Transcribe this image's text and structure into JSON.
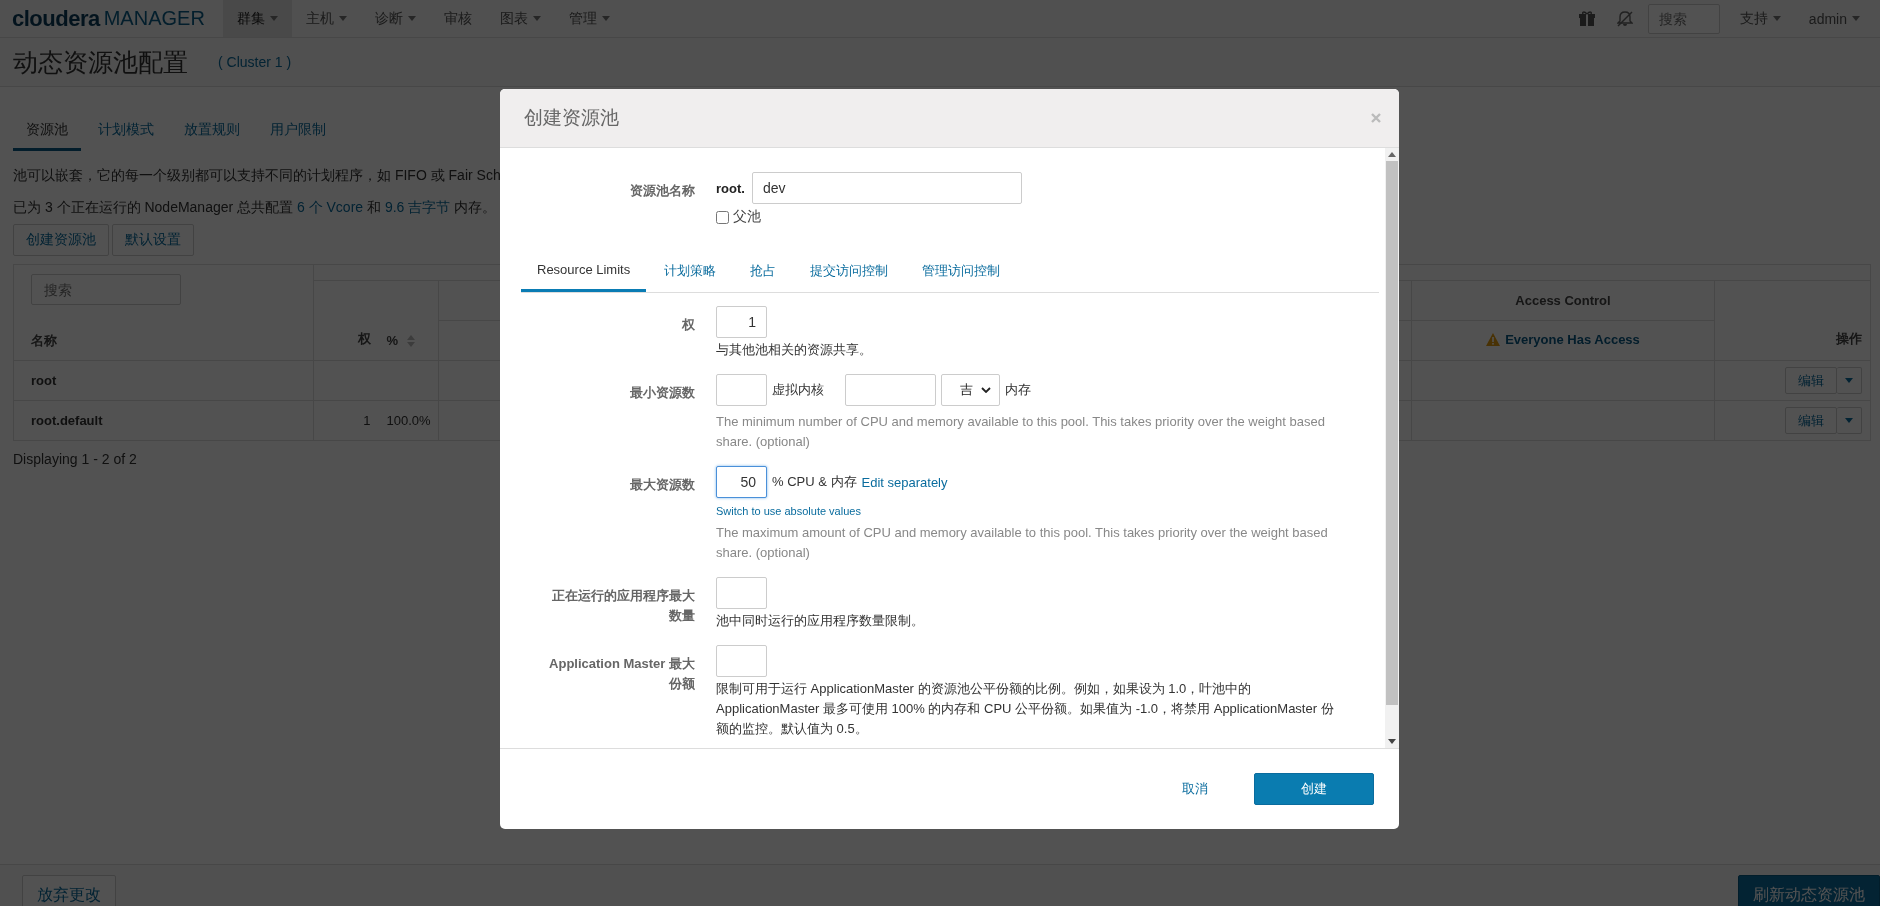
{
  "navbar": {
    "logo": {
      "brand": "cloudera",
      "product": "MANAGER"
    },
    "menus": [
      {
        "label": "群集",
        "dropdown": true,
        "selected": true
      },
      {
        "label": "主机",
        "dropdown": true,
        "selected": false
      },
      {
        "label": "诊断",
        "dropdown": true,
        "selected": false
      },
      {
        "label": "审核",
        "dropdown": false,
        "selected": false
      },
      {
        "label": "图表",
        "dropdown": true,
        "selected": false
      },
      {
        "label": "管理",
        "dropdown": true,
        "selected": false
      }
    ],
    "search": {
      "placeholder": "搜索"
    },
    "user_menus": [
      {
        "label": "支持",
        "dropdown": true
      },
      {
        "label": "admin",
        "dropdown": true
      }
    ]
  },
  "page": {
    "title": "动态资源池配置",
    "cluster": "( Cluster 1 )"
  },
  "tabs": [
    {
      "label": "资源池",
      "selected": true
    },
    {
      "label": "计划模式",
      "selected": false
    },
    {
      "label": "放置规则",
      "selected": false
    },
    {
      "label": "用户限制",
      "selected": false
    }
  ],
  "description": "池可以嵌套，它的每一个级别都可以支持不同的计划程序，如 FIFO 或 Fair Sch",
  "summary": [
    {
      "text": "已为 3 个正在运行的 NodeManager 总共配置 ",
      "link": false
    },
    {
      "text": "6 个 Vcore",
      "link": true
    },
    {
      "text": " 和 ",
      "link": false
    },
    {
      "text": "9.6 吉字节",
      "link": true
    },
    {
      "text": " 内存。",
      "link": false
    }
  ],
  "buttons": [
    "创建资源池",
    "默认设置"
  ],
  "table": {
    "search": {
      "placeholder": "搜索"
    },
    "columns": {
      "name": "名称",
      "weight": "权",
      "percent": "%",
      "access_group": "Access Control",
      "access": "Everyone Has Access",
      "actions": "操作"
    },
    "rows": [
      {
        "name": "root",
        "action": "编辑"
      },
      {
        "name": "root.default",
        "weight": "1",
        "percent": "100.0%",
        "action": "编辑"
      }
    ],
    "footer": "Displaying 1 - 2 of 2"
  },
  "modal": {
    "title": "创建资源池",
    "name_label": "资源池名称",
    "name_prefix": "root.",
    "name_value": "dev",
    "parent": {
      "label": "父池",
      "checked": false
    },
    "tabs": [
      {
        "label": "Resource Limits",
        "selected": true
      },
      {
        "label": "计划策略",
        "selected": false
      },
      {
        "label": "抢占",
        "selected": false
      },
      {
        "label": "提交访问控制",
        "selected": false
      },
      {
        "label": "管理访问控制",
        "selected": false
      }
    ],
    "fields": [
      {
        "kind": "weight",
        "label": "权",
        "value": "1",
        "help": "与其他池相关的资源共享。"
      },
      {
        "kind": "min",
        "label": "最小资源数",
        "cores_unit": "虚拟内核",
        "mem_unit": "吉",
        "mem_label": "内存",
        "help": "The minimum number of CPU and memory available to this pool. This takes priority over the weight based share. (optional)"
      },
      {
        "kind": "max",
        "label": "最大资源数",
        "value": "50",
        "focused": true,
        "unit": "% CPU & 内存",
        "link": "Edit separately",
        "switch_link": "Switch to use absolute values",
        "help": "The maximum amount of CPU and memory available to this pool. This takes priority over the weight based share. (optional)"
      },
      {
        "kind": "plain",
        "label": "正在运行的应用程序最大数量",
        "help": "池中同时运行的应用程序数量限制。"
      },
      {
        "kind": "plain",
        "label": "Application Master 最大份额",
        "help": "限制可用于运行 ApplicationMaster 的资源池公平份额的比例。例如，如果设为 1.0，叶池中的 ApplicationMaster 最多可使用 100% 的内存和 CPU 公平份额。如果值为 -1.0，将禁用 ApplicationMaster 份额的监控。默认值为 0.5。"
      }
    ],
    "cancel": "取消",
    "create": "创建"
  },
  "footer": {
    "discard": "放弃更改",
    "refresh": "刷新动态资源池"
  }
}
